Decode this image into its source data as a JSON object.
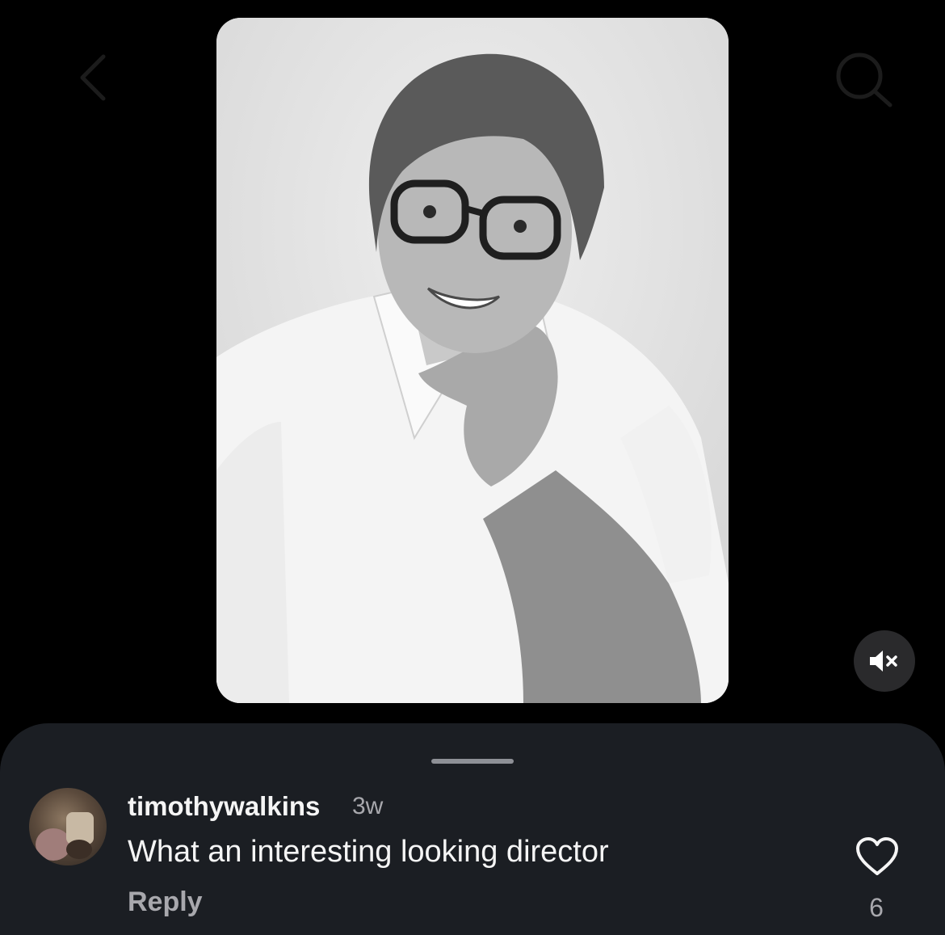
{
  "header": {
    "back_icon": "chevron-left-icon",
    "search_icon": "search-icon"
  },
  "media": {
    "image_alt": "black and white portrait of a smiling man with glasses resting his chin on his hand",
    "mute_icon": "speaker-muted-icon"
  },
  "comments_sheet": {
    "comment": {
      "username": "timothywalkins",
      "time": "3w",
      "text": "What an interesting looking director",
      "reply_label": "Reply",
      "like_count": "6"
    }
  },
  "colors": {
    "background": "#000000",
    "sheet": "#1b1e23",
    "primary_text": "#f5f5f5",
    "secondary_text": "#a8a8ad"
  }
}
